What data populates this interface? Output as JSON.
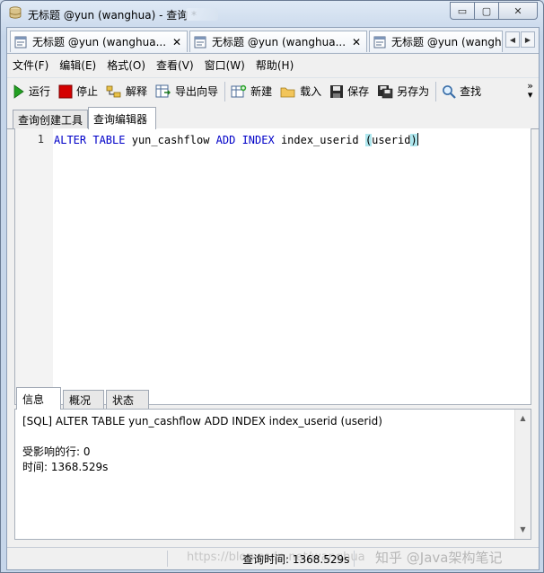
{
  "window": {
    "title": "无标题 @yun (wanghua) - 查询 *",
    "buttons": {
      "minimize": "▭",
      "maximize": "▢",
      "close": "✕"
    }
  },
  "doc_tabs": [
    {
      "label": "无标题 @yun (wanghua..."
    },
    {
      "label": "无标题 @yun (wanghua..."
    },
    {
      "label": "无标题 @yun (wangh"
    }
  ],
  "tab_scroll": {
    "left": "◀",
    "right": "▶"
  },
  "menu": [
    "文件(F)",
    "编辑(E)",
    "格式(O)",
    "查看(V)",
    "窗口(W)",
    "帮助(H)"
  ],
  "toolbar": {
    "run": "运行",
    "stop": "停止",
    "explain": "解释",
    "export_wizard": "导出向导",
    "new": "新建",
    "load": "载入",
    "save": "保存",
    "save_as": "另存为",
    "find": "查找",
    "more": "»"
  },
  "editor_tabs": [
    "查询创建工具",
    "查询编辑器"
  ],
  "editor": {
    "line_number": "1",
    "code": {
      "kw1": "ALTER",
      "kw2": "TABLE",
      "table": "yun_cashflow",
      "kw3": "ADD",
      "kw4": "INDEX",
      "index": "index_userid",
      "paren_open": "(",
      "column": "userid",
      "paren_close": ")"
    }
  },
  "result_tabs": [
    "信息",
    "概况",
    "状态"
  ],
  "messages": {
    "sql": "[SQL] ALTER TABLE yun_cashflow ADD INDEX index_userid (userid)",
    "affected": "受影响的行: 0",
    "time": "时间: 1368.529s"
  },
  "status": {
    "query_time": "查询时间: 1368.529s",
    "watermark_url": "https://blog.csdn.net/wanghua",
    "watermark_brand": "知乎 @Java架构笔记"
  },
  "colors": {
    "keyword": "#0000c8",
    "paren_highlight": "#aee7ee",
    "stop_red": "#d40000",
    "run_green": "#22a022"
  }
}
